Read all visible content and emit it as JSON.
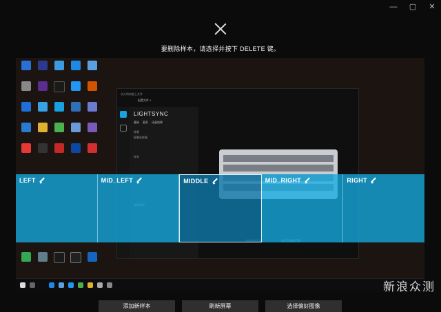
{
  "window": {
    "min_glyph": "—",
    "max_glyph": "▢",
    "close_glyph": "✕"
  },
  "instruction": "要删除样本，请选择并按下 DELETE 键。",
  "capture": {
    "app_title": "永久的刻度上文件",
    "app_profile": "配置文件 1",
    "panel_title": "LIGHTSYNC",
    "panel_tabs": [
      "基础",
      "更多",
      "动画效果"
    ],
    "panel_line1": "效果",
    "panel_line2": "屏幕采样器",
    "panel_line3": "样本",
    "panel_line4": "选择采样",
    "legend1": "创建样本区域",
    "legend2": "选区至键盘范围"
  },
  "zones": [
    {
      "label": "LEFT"
    },
    {
      "label": "MID_LEFT"
    },
    {
      "label": "MIDDLE"
    },
    {
      "label": "MID_RIGHT"
    },
    {
      "label": "RIGHT"
    }
  ],
  "buttons": {
    "add_sample": "添加新样本",
    "refresh_screen": "刷新屏幕",
    "choose_image": "选择偏好图像"
  },
  "watermark": "新浪众测",
  "colors": {
    "zone": "#14aae1",
    "active_zone": "#0e78aa",
    "button": "#2f2f2f"
  }
}
